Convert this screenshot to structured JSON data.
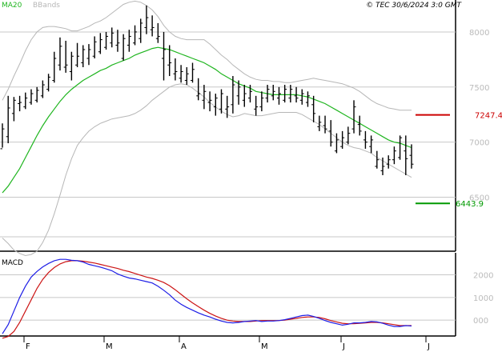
{
  "header": {
    "ma_label": "MA20",
    "bb_label": "BBands",
    "copyright": "© TEC 30/6/2024 3:0 GMT"
  },
  "macd_panel": {
    "title": "MACD"
  },
  "colors": {
    "price_bar": "#000000",
    "ma": "#1fb51f",
    "bands": "#b7b7b7",
    "macd_line": "#1e1ee6",
    "signal_line": "#cc1414",
    "resistance": "#cc0000",
    "support": "#009900",
    "grid": "#c8c8c8"
  },
  "chart_data": [
    {
      "type": "line",
      "subtype": "ohlc",
      "x_ticks": [
        "F",
        "M",
        "A",
        "M",
        "J",
        "J"
      ],
      "y_ticks": [
        800,
        750,
        700,
        650
      ],
      "y_tick_labels": [
        "8000",
        "7500",
        "7000",
        "6500"
      ],
      "ylim": [
        6010,
        8290
      ],
      "series": [
        {
          "name": "Price",
          "values": [
            [
              6940,
              7170,
              6950,
              7120
            ],
            [
              7050,
              7420,
              6990,
              7310
            ],
            [
              7260,
              7410,
              7190,
              7380
            ],
            [
              7350,
              7420,
              7280,
              7360
            ],
            [
              7320,
              7450,
              7300,
              7400
            ],
            [
              7360,
              7480,
              7340,
              7440
            ],
            [
              7380,
              7500,
              7360,
              7470
            ],
            [
              7420,
              7560,
              7400,
              7520
            ],
            [
              7480,
              7620,
              7460,
              7590
            ],
            [
              7560,
              7820,
              7540,
              7760
            ],
            [
              7700,
              7950,
              7650,
              7870
            ],
            [
              7680,
              7920,
              7630,
              7700
            ],
            [
              7640,
              7820,
              7560,
              7780
            ],
            [
              7700,
              7900,
              7680,
              7780
            ],
            [
              7720,
              7880,
              7680,
              7840
            ],
            [
              7760,
              7890,
              7700,
              7840
            ],
            [
              7780,
              7960,
              7760,
              7910
            ],
            [
              7820,
              7990,
              7800,
              7930
            ],
            [
              7860,
              8000,
              7840,
              7960
            ],
            [
              7900,
              8040,
              7860,
              7990
            ],
            [
              7880,
              8020,
              7820,
              7900
            ],
            [
              7760,
              7980,
              7740,
              7940
            ],
            [
              7880,
              8020,
              7820,
              7960
            ],
            [
              7900,
              8060,
              7880,
              8000
            ],
            [
              7940,
              8120,
              7900,
              8080
            ],
            [
              8040,
              8240,
              7980,
              8130
            ],
            [
              8020,
              8150,
              7960,
              8040
            ],
            [
              7940,
              8080,
              7900,
              7960
            ],
            [
              7760,
              8000,
              7560,
              7840
            ],
            [
              7700,
              7880,
              7600,
              7720
            ],
            [
              7620,
              7760,
              7560,
              7640
            ],
            [
              7580,
              7700,
              7540,
              7640
            ],
            [
              7560,
              7680,
              7520,
              7620
            ],
            [
              7560,
              7720,
              7540,
              7660
            ],
            [
              7420,
              7580,
              7380,
              7440
            ],
            [
              7380,
              7520,
              7300,
              7460
            ],
            [
              7360,
              7460,
              7280,
              7380
            ],
            [
              7320,
              7440,
              7240,
              7400
            ],
            [
              7300,
              7480,
              7260,
              7440
            ],
            [
              7300,
              7420,
              7220,
              7320
            ],
            [
              7340,
              7600,
              7260,
              7520
            ],
            [
              7420,
              7560,
              7340,
              7500
            ],
            [
              7380,
              7520,
              7320,
              7440
            ],
            [
              7400,
              7520,
              7360,
              7460
            ],
            [
              7300,
              7420,
              7240,
              7320
            ],
            [
              7320,
              7460,
              7280,
              7400
            ],
            [
              7400,
              7520,
              7360,
              7480
            ],
            [
              7420,
              7520,
              7380,
              7460
            ],
            [
              7400,
              7500,
              7340,
              7440
            ],
            [
              7380,
              7520,
              7360,
              7480
            ],
            [
              7400,
              7520,
              7360,
              7480
            ],
            [
              7420,
              7500,
              7360,
              7400
            ],
            [
              7380,
              7480,
              7340,
              7440
            ],
            [
              7360,
              7460,
              7320,
              7420
            ],
            [
              7340,
              7420,
              7180,
              7260
            ],
            [
              7140,
              7240,
              7100,
              7180
            ],
            [
              7150,
              7240,
              7080,
              7120
            ],
            [
              7100,
              7200,
              6960,
              7000
            ],
            [
              6920,
              7080,
              6900,
              7020
            ],
            [
              6960,
              7100,
              6940,
              7040
            ],
            [
              7000,
              7140,
              6980,
              7080
            ],
            [
              7120,
              7380,
              7080,
              7320
            ],
            [
              7160,
              7240,
              7060,
              7100
            ],
            [
              7020,
              7100,
              6940,
              7000
            ],
            [
              6960,
              7060,
              6900,
              7020
            ],
            [
              6780,
              6920,
              6760,
              6840
            ],
            [
              6740,
              6860,
              6700,
              6780
            ],
            [
              6800,
              6880,
              6760,
              6840
            ],
            [
              6840,
              6960,
              6800,
              6920
            ],
            [
              6860,
              7060,
              6840,
              7040
            ],
            [
              6920,
              7060,
              6700,
              6850
            ],
            [
              6880,
              6980,
              6760,
              6800
            ]
          ]
        },
        {
          "name": "MA20",
          "values": [
            6540,
            6600,
            6680,
            6760,
            6860,
            6960,
            7060,
            7150,
            7230,
            7300,
            7370,
            7430,
            7480,
            7520,
            7560,
            7590,
            7620,
            7650,
            7670,
            7700,
            7720,
            7740,
            7760,
            7790,
            7810,
            7830,
            7850,
            7860,
            7850,
            7840,
            7820,
            7800,
            7780,
            7760,
            7740,
            7720,
            7690,
            7660,
            7620,
            7590,
            7560,
            7530,
            7510,
            7490,
            7460,
            7450,
            7440,
            7430,
            7430,
            7430,
            7430,
            7430,
            7420,
            7410,
            7390,
            7370,
            7350,
            7320,
            7290,
            7260,
            7230,
            7200,
            7170,
            7140,
            7110,
            7080,
            7050,
            7020,
            7000,
            6990,
            6970,
            6950
          ]
        },
        {
          "name": "BBands upper",
          "values": [
            7380,
            7480,
            7600,
            7710,
            7830,
            7930,
            8000,
            8040,
            8050,
            8050,
            8040,
            8030,
            8010,
            8010,
            8030,
            8050,
            8080,
            8100,
            8130,
            8170,
            8210,
            8250,
            8270,
            8280,
            8270,
            8240,
            8200,
            8140,
            8060,
            8000,
            7960,
            7940,
            7930,
            7930,
            7930,
            7930,
            7890,
            7840,
            7790,
            7750,
            7700,
            7660,
            7620,
            7590,
            7570,
            7560,
            7560,
            7550,
            7550,
            7540,
            7540,
            7550,
            7560,
            7570,
            7580,
            7570,
            7560,
            7550,
            7540,
            7530,
            7510,
            7490,
            7460,
            7420,
            7380,
            7350,
            7330,
            7310,
            7300,
            7290,
            7290,
            7290
          ]
        },
        {
          "name": "BBands lower",
          "values": [
            6130,
            6080,
            6020,
            5990,
            5970,
            5980,
            6010,
            6090,
            6200,
            6350,
            6520,
            6700,
            6850,
            6970,
            7040,
            7100,
            7140,
            7170,
            7190,
            7210,
            7220,
            7230,
            7240,
            7260,
            7290,
            7330,
            7380,
            7420,
            7460,
            7500,
            7520,
            7530,
            7520,
            7490,
            7450,
            7410,
            7360,
            7320,
            7280,
            7250,
            7230,
            7240,
            7260,
            7250,
            7240,
            7240,
            7250,
            7260,
            7270,
            7270,
            7270,
            7270,
            7250,
            7220,
            7190,
            7160,
            7120,
            7080,
            7040,
            7000,
            6970,
            6950,
            6940,
            6920,
            6900,
            6860,
            6830,
            6800,
            6770,
            6740,
            6710,
            6680
          ]
        }
      ],
      "levels": [
        {
          "label": "7247.4",
          "display": "7247.4",
          "value": 7247.4,
          "kind": "resistance"
        },
        {
          "label": "6443.9",
          "display": "6443.9",
          "value": 6443.9,
          "kind": "support"
        }
      ]
    },
    {
      "type": "line",
      "title": "MACD",
      "y_ticks": [
        200,
        100,
        0
      ],
      "y_tick_labels": [
        "2000",
        "1000",
        "000"
      ],
      "ylim": [
        -70,
        290
      ],
      "series": [
        {
          "name": "MACD",
          "values": [
            -60,
            -20,
            40,
            100,
            150,
            190,
            215,
            235,
            250,
            262,
            268,
            268,
            264,
            262,
            256,
            246,
            240,
            234,
            226,
            218,
            204,
            194,
            186,
            182,
            176,
            170,
            164,
            150,
            132,
            112,
            88,
            70,
            56,
            44,
            32,
            22,
            14,
            4,
            -4,
            -10,
            -12,
            -10,
            -6,
            -4,
            -2,
            -6,
            -4,
            -4,
            -2,
            2,
            8,
            14,
            20,
            22,
            16,
            8,
            -2,
            -10,
            -16,
            -22,
            -18,
            -12,
            -12,
            -10,
            -6,
            -8,
            -14,
            -22,
            -28,
            -28,
            -24,
            -26
          ]
        },
        {
          "name": "Signal",
          "values": [
            -80,
            -72,
            -50,
            -10,
            40,
            90,
            140,
            180,
            210,
            232,
            248,
            258,
            262,
            262,
            260,
            256,
            252,
            246,
            240,
            234,
            228,
            220,
            214,
            206,
            198,
            190,
            184,
            176,
            166,
            152,
            134,
            114,
            94,
            76,
            60,
            44,
            30,
            18,
            8,
            0,
            -4,
            -6,
            -6,
            -6,
            -4,
            -2,
            -2,
            -2,
            -2,
            0,
            4,
            8,
            12,
            14,
            14,
            12,
            6,
            -2,
            -8,
            -14,
            -16,
            -16,
            -14,
            -12,
            -10,
            -10,
            -12,
            -16,
            -20,
            -24,
            -24,
            -24
          ]
        }
      ]
    }
  ]
}
